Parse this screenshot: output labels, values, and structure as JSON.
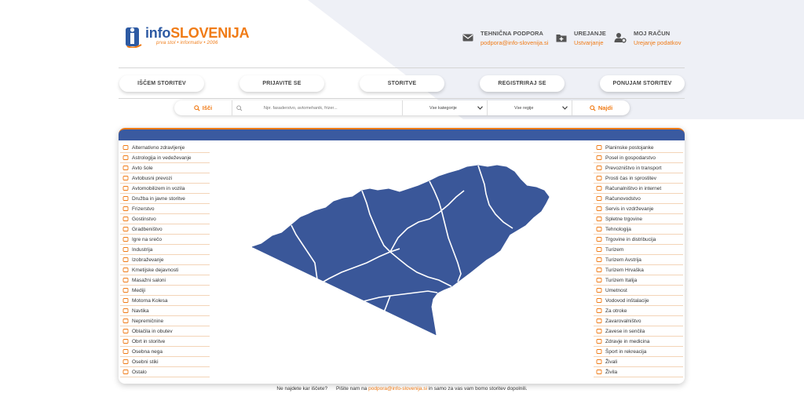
{
  "brand": {
    "name_part1": "info",
    "name_part2": "SLOVENIJA",
    "tagline": "prva stol • informativ • 2006"
  },
  "header": {
    "support": {
      "title": "TEHNIČNA PODPORA",
      "sub": "podpora@info-slovenija.si",
      "icon": "mail-icon"
    },
    "edit": {
      "title": "UREJANJE",
      "sub": "Ustvarjanje",
      "icon": "add-icon"
    },
    "account": {
      "title": "MOJ RAČUN",
      "sub": "Urejanje podatkov",
      "icon": "user-settings-icon"
    }
  },
  "nav": [
    "IŠČEM STORITEV",
    "PRIJAVITE SE",
    "STORITVE",
    "REGISTRIRAJ SE",
    "PONUJAM STORITEV"
  ],
  "search": {
    "left_label": "Išči",
    "placeholder": "Npr. fasaderstvo, avtomehanik, frizer...",
    "category": "Vse kategorije",
    "region": "Vse regije",
    "submit": "Najdi"
  },
  "categories_left": [
    {
      "label": "Alternativno zdravljenje",
      "icon": "leaf-icon"
    },
    {
      "label": "Astrologija in vedeževanje",
      "icon": "crystal-icon"
    },
    {
      "label": "Avto šole",
      "icon": "car-icon"
    },
    {
      "label": "Avtobusni prevozi",
      "icon": "bus-icon"
    },
    {
      "label": "Avtomobilizem in vozila",
      "icon": "vehicle-icon"
    },
    {
      "label": "Družba in javne storitve",
      "icon": "people-icon"
    },
    {
      "label": "Frizerstvo",
      "icon": "scissors-icon"
    },
    {
      "label": "Gostinstvo",
      "icon": "cutlery-icon"
    },
    {
      "label": "Gradbeništvo",
      "icon": "building-icon"
    },
    {
      "label": "Igre na srečo",
      "icon": "dice-icon"
    },
    {
      "label": "Industrija",
      "icon": "factory-icon"
    },
    {
      "label": "Izobraževanje",
      "icon": "education-icon"
    },
    {
      "label": "Kmetijske dejavnosti",
      "icon": "wheat-icon"
    },
    {
      "label": "Masažni saloni",
      "icon": "massage-icon"
    },
    {
      "label": "Mediji",
      "icon": "media-icon"
    },
    {
      "label": "Motorna Kolesa",
      "icon": "motorcycle-icon"
    },
    {
      "label": "Navtika",
      "icon": "anchor-icon"
    },
    {
      "label": "Nepremičnine",
      "icon": "house-icon"
    },
    {
      "label": "Oblačila in obutev",
      "icon": "tag-icon"
    },
    {
      "label": "Obrt in storitve",
      "icon": "tools-icon"
    },
    {
      "label": "Osebna nega",
      "icon": "care-icon"
    },
    {
      "label": "Osebni stiki",
      "icon": "contacts-icon"
    },
    {
      "label": "Ostalo",
      "icon": "menu-icon"
    }
  ],
  "categories_right": [
    {
      "label": "Planinske postojanke",
      "icon": "mountain-icon"
    },
    {
      "label": "Posel in gospodarstvo",
      "icon": "briefcase-icon"
    },
    {
      "label": "Prevozništvo in transport",
      "icon": "truck-icon"
    },
    {
      "label": "Prosti čas in sprostitev",
      "icon": "headphones-icon"
    },
    {
      "label": "Računalništvo in internet",
      "icon": "computer-icon"
    },
    {
      "label": "Računovodstvo",
      "icon": "euro-icon"
    },
    {
      "label": "Servis in vzdrževanje",
      "icon": "wrench-icon"
    },
    {
      "label": "Spletne trgovine",
      "icon": "basket-icon"
    },
    {
      "label": "Tehnologija",
      "icon": "tech-icon"
    },
    {
      "label": "Trgovine in distribucija",
      "icon": "cart-icon"
    },
    {
      "label": "Turizem",
      "icon": "flag-icon"
    },
    {
      "label": "Turizem Avstrija",
      "icon": "flag-icon"
    },
    {
      "label": "Turizem Hrvaška",
      "icon": "flag-icon"
    },
    {
      "label": "Turizem Italija",
      "icon": "flag-icon"
    },
    {
      "label": "Umetnost",
      "icon": "art-icon"
    },
    {
      "label": "Vodovod inštalacije",
      "icon": "pipe-icon"
    },
    {
      "label": "Za otroke",
      "icon": "child-icon"
    },
    {
      "label": "Zavarovalništvo",
      "icon": "insurance-icon"
    },
    {
      "label": "Zavese in senčila",
      "icon": "curtain-icon"
    },
    {
      "label": "Zdravje in medicina",
      "icon": "health-icon"
    },
    {
      "label": "Šport in rekreacija",
      "icon": "bike-icon"
    },
    {
      "label": "Živali",
      "icon": "paw-icon"
    },
    {
      "label": "Živila",
      "icon": "food-icon"
    }
  ],
  "footer": {
    "q": "Ne najdete kar iščete?",
    "pre": "Pišite nam na",
    "email": "podpora@info-slovenija.si",
    "post": "in samo za vas vam bomo storitev dopolnili."
  },
  "colors": {
    "brand_blue": "#3a5aa0",
    "accent_orange": "#f07b16",
    "map_fill": "#3a5799"
  }
}
